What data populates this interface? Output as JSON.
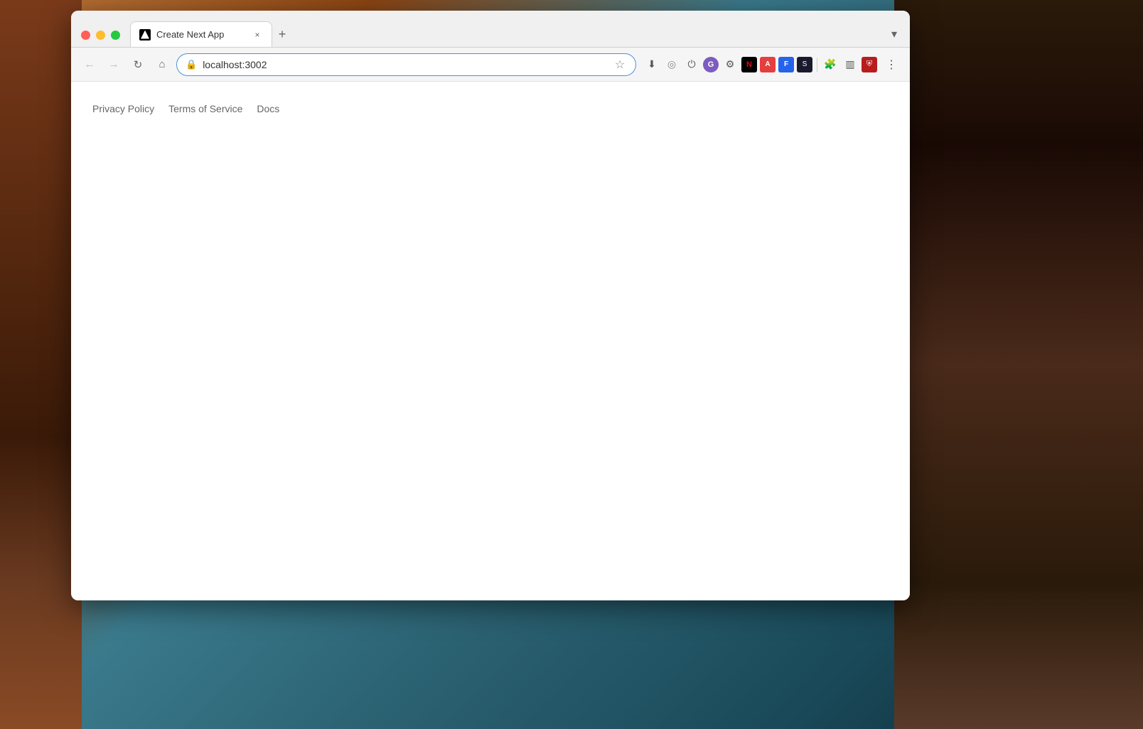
{
  "desktop": {
    "bg_description": "Gaming wallpaper with colorful characters"
  },
  "browser": {
    "tab": {
      "title": "Create Next App",
      "favicon_alt": "Next.js favicon"
    },
    "new_tab_label": "+",
    "dropdown_label": "▾",
    "nav": {
      "back_label": "←",
      "forward_label": "→",
      "refresh_label": "↻",
      "home_label": "⌂",
      "url": "localhost:3002",
      "bookmark_label": "☆"
    },
    "extensions": [
      {
        "id": "download",
        "symbol": "⬇"
      },
      {
        "id": "circle",
        "symbol": "◎"
      },
      {
        "id": "power",
        "symbol": "⏻"
      },
      {
        "id": "purple-g",
        "symbol": "G"
      },
      {
        "id": "gear",
        "symbol": "⚙"
      },
      {
        "id": "n-black",
        "symbol": "N"
      },
      {
        "id": "red-a",
        "symbol": "A"
      },
      {
        "id": "blue-f",
        "symbol": "F"
      },
      {
        "id": "dark-s",
        "symbol": "S"
      },
      {
        "id": "puzzle",
        "symbol": "🧩"
      },
      {
        "id": "sidebar",
        "symbol": "▥"
      },
      {
        "id": "shield-red",
        "symbol": "⛨"
      }
    ],
    "menu_label": "⋮"
  },
  "page": {
    "nav_links": [
      {
        "id": "privacy",
        "label": "Privacy Policy"
      },
      {
        "id": "terms",
        "label": "Terms of Service"
      },
      {
        "id": "docs",
        "label": "Docs"
      }
    ]
  }
}
